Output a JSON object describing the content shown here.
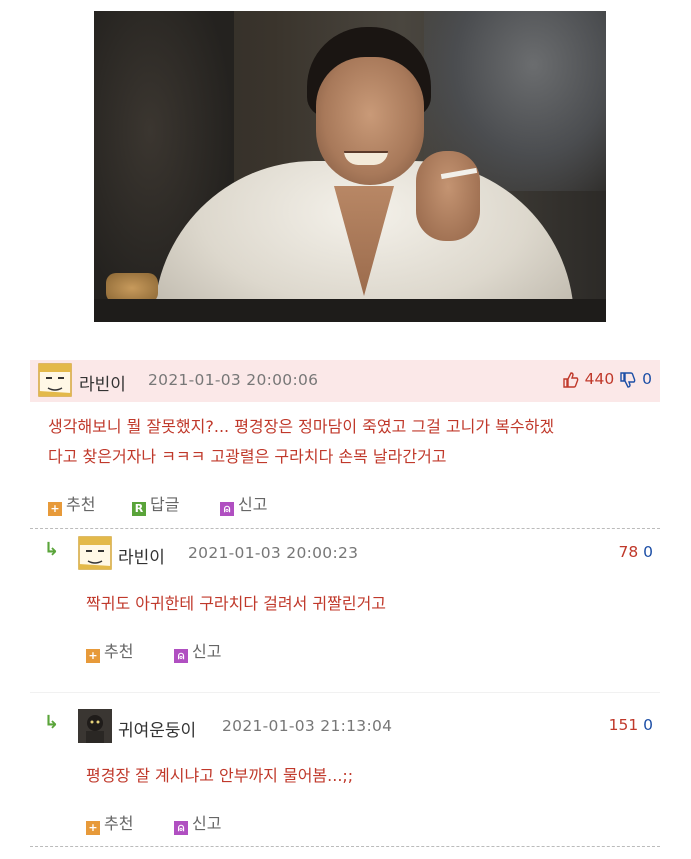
{
  "image": {
    "alt_icon": "photo"
  },
  "comments": [
    {
      "author": "라빈이",
      "date": "2021-01-03 20:00:06",
      "up": "440",
      "down": "0",
      "text_line1": "생각해보니 뭘 잘못했지?... 평경장은 정마담이 죽였고 그걸 고니가 복수하겠",
      "text_line2": "다고 찾은거자나 ㅋㅋㅋ 고광렬은 구라치다 손목 날라간거고",
      "act_recommend": "추천",
      "act_reply": "답글",
      "act_report": "신고"
    },
    {
      "author": "라빈이",
      "date": "2021-01-03 20:00:23",
      "up": "78",
      "down": "0",
      "text_line1": "짝귀도 아귀한테 구라치다 걸려서 귀짤린거고",
      "act_recommend": "추천",
      "act_report": "신고"
    },
    {
      "author": "귀여운둥이",
      "date": "2021-01-03 21:13:04",
      "up": "151",
      "down": "0",
      "text_line1": "평경장 잘 계시냐고 안부까지 물어봄...;;",
      "act_recommend": "추천",
      "act_report": "신고"
    }
  ],
  "colors": {
    "accent_red": "#c0392b",
    "down_blue": "#1d4fa6",
    "reply_green": "#5aa43a",
    "header_pink": "#fbe8e8"
  }
}
